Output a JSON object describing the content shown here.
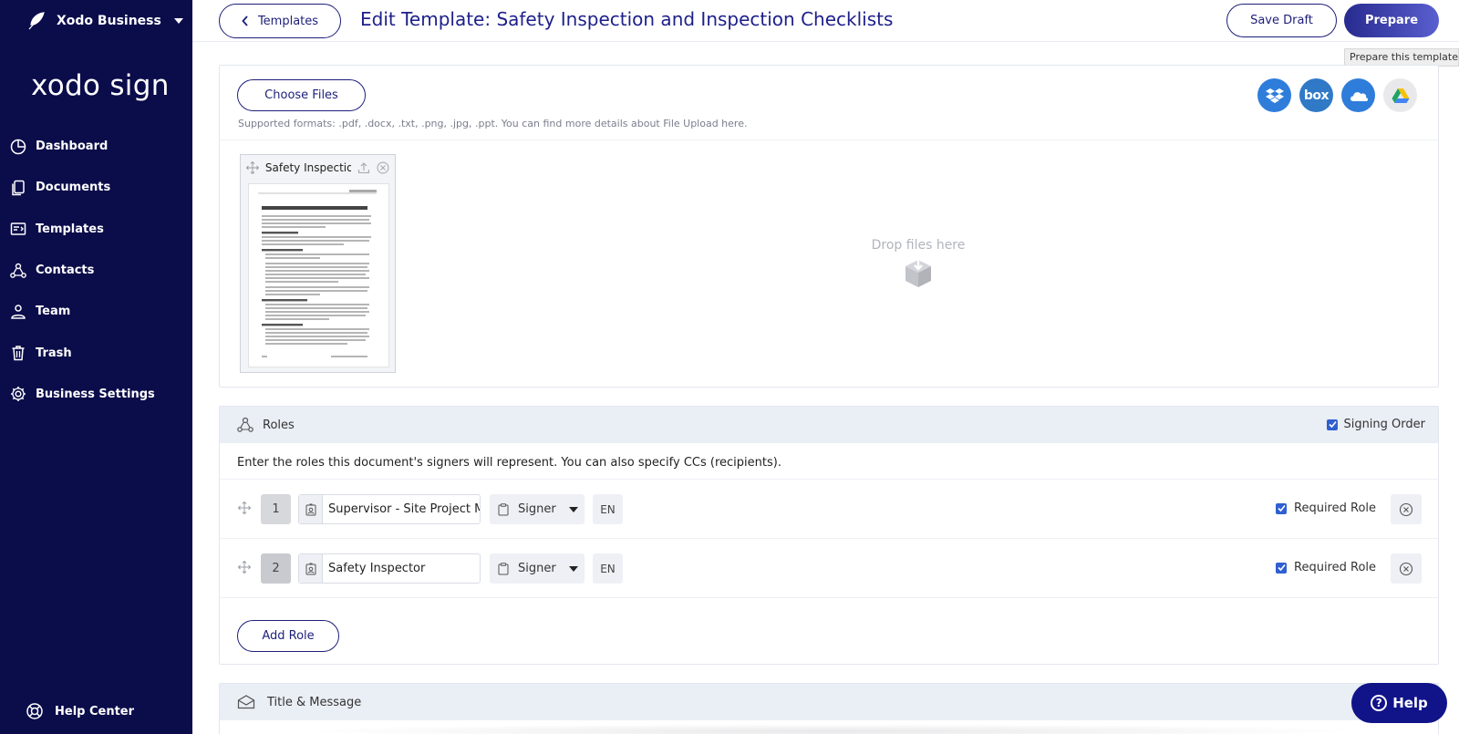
{
  "sidebar": {
    "org_name": "Xodo Business",
    "brand": "xodo sign",
    "items": [
      {
        "label": "Dashboard",
        "icon": "dashboard-icon"
      },
      {
        "label": "Documents",
        "icon": "documents-icon"
      },
      {
        "label": "Templates",
        "icon": "templates-icon"
      },
      {
        "label": "Contacts",
        "icon": "contacts-icon"
      },
      {
        "label": "Team",
        "icon": "team-icon"
      },
      {
        "label": "Trash",
        "icon": "trash-icon"
      },
      {
        "label": "Business Settings",
        "icon": "gear-icon"
      }
    ],
    "help_center": "Help Center"
  },
  "header": {
    "back_label": "Templates",
    "title": "Edit Template: Safety Inspection and Inspection Checklists",
    "save_draft_label": "Save Draft",
    "prepare_label": "Prepare",
    "prepare_tooltip": "Prepare this template"
  },
  "upload": {
    "choose_files_label": "Choose Files",
    "supported_formats": "Supported formats: .pdf, .docx, .txt, .png, .jpg, .ppt. You can find more details about File Upload here.",
    "cloud_services": [
      {
        "name": "dropbox-icon",
        "color": "#2f7ddb"
      },
      {
        "name": "box-icon",
        "color": "#2f79c7",
        "text": "box"
      },
      {
        "name": "onedrive-icon",
        "color": "#2f7ddb"
      },
      {
        "name": "google-drive-icon",
        "color": "#e9e9ec"
      }
    ],
    "file": {
      "name": "Safety Inspectio…"
    },
    "drop_text": "Drop files here"
  },
  "roles": {
    "title": "Roles",
    "signing_order_label": "Signing Order",
    "description": "Enter the roles this document's signers will represent. You can also specify CCs (recipients).",
    "rows": [
      {
        "number": "1",
        "name": "Supervisor - Site Project M",
        "type": "Signer",
        "lang": "EN",
        "required_label": "Required Role"
      },
      {
        "number": "2",
        "name": "Safety Inspector",
        "type": "Signer",
        "lang": "EN",
        "required_label": "Required Role"
      }
    ],
    "add_role_label": "Add Role"
  },
  "title_message": {
    "title": "Title & Message"
  },
  "help_button": {
    "label": "Help"
  },
  "colors": {
    "sidebar_bg": "#0b0c4a",
    "accent": "#1d1f7a",
    "checkbox": "#2f5fd0"
  }
}
